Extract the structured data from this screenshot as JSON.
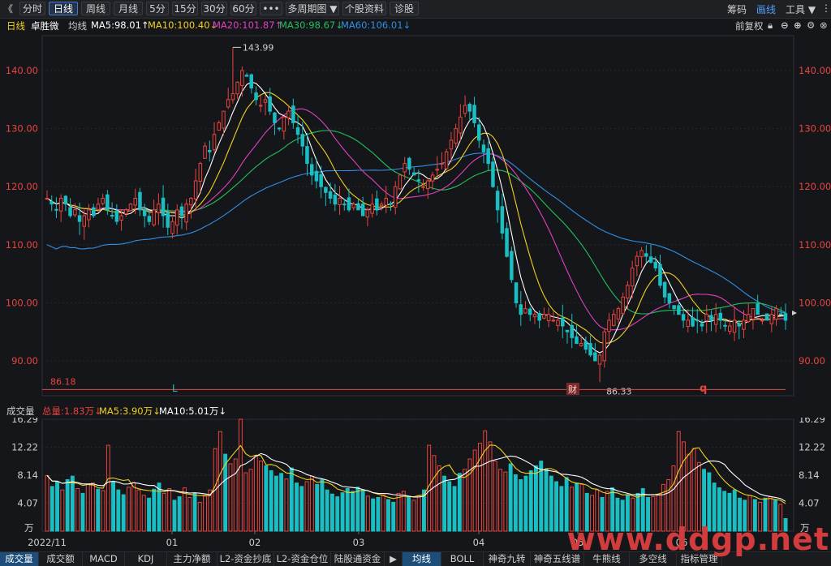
{
  "toolbar": {
    "back": "《",
    "buttons": [
      "分时",
      "日线",
      "周线",
      "月线",
      "5分",
      "15分",
      "30分",
      "60分",
      "•••",
      "多周期图 ▼",
      "个股资料",
      "诊股"
    ],
    "active_index": 1,
    "right": {
      "chips": "筹码",
      "draw": "画线",
      "tools": "工具 ▼"
    }
  },
  "info": {
    "period": "日线",
    "name": "卓胜微",
    "ma_label": "均线",
    "ma5": "MA5:98.01↑",
    "ma10": "MA10:100.40↓",
    "ma20": "MA20:101.87↑",
    "ma30": "MA30:98.67↓",
    "ma60": "MA60:106.01↓",
    "adjust": "前复权",
    "icons": [
      "lock-icon",
      "minus-icon",
      "plus-icon",
      "settings-icon",
      "close-icon"
    ]
  },
  "colors": {
    "up": "#e8443e",
    "down": "#19bfc3",
    "ma5": "#ffffff",
    "ma10": "#f0d020",
    "ma20": "#e040c0",
    "ma30": "#22c05a",
    "ma60": "#2f8fe6",
    "axis": "#e8443e"
  },
  "price_axis": {
    "labels": [
      "140.00",
      "130.00",
      "120.00",
      "110.00",
      "100.00",
      "90.00"
    ],
    "max_label": "143.99",
    "min_label": "86.33",
    "hline_label": "86.18",
    "markers": {
      "l": "L",
      "cai": "财",
      "q": "q"
    }
  },
  "vol_header": {
    "title": "成交量",
    "total": "总量:1.83万↓",
    "ma5": "MA5:3.90万↓",
    "ma10": "MA10:5.01万↓"
  },
  "vol_axis": {
    "labels": [
      "16.29",
      "12.22",
      "8.14",
      "4.07"
    ],
    "unit": "万"
  },
  "x_axis": {
    "labels": [
      "2022/11",
      "01",
      "02",
      "03",
      "04",
      "05",
      "06"
    ]
  },
  "bottom_tabs": [
    "成交量",
    "成交额",
    "MACD",
    "KDJ",
    "主力净额",
    "L2-资金抄底",
    "L2-资金仓位",
    "陆股通资金",
    "▶",
    "均线",
    "BOLL",
    "神奇九转",
    "神奇五线谱",
    "牛熊线",
    "多空线",
    "指标管理"
  ],
  "watermark": "www.ddgp.net",
  "chart_data": {
    "type": "candlestick",
    "ylim": [
      84,
      146
    ],
    "candles_count": 174,
    "closes": [
      118,
      117,
      116,
      118,
      117,
      115,
      116,
      114,
      115,
      116,
      115,
      117,
      118,
      116,
      115,
      114,
      115,
      116,
      117,
      118,
      116,
      115,
      114,
      116,
      117,
      115,
      113,
      114,
      116,
      115,
      117,
      118,
      121,
      124,
      127,
      126,
      129,
      131,
      133,
      135,
      136,
      138,
      140,
      139,
      137,
      135,
      134,
      135,
      133,
      131,
      130,
      132,
      133,
      131,
      129,
      127,
      124,
      122,
      121,
      120,
      119,
      118,
      117,
      118,
      117,
      116,
      117,
      116,
      115,
      116,
      117,
      116,
      117,
      118,
      117,
      120,
      122,
      124,
      123,
      122,
      121,
      120,
      121,
      122,
      123,
      124,
      126,
      128,
      130,
      132,
      134,
      133,
      131,
      128,
      126,
      124,
      120,
      116,
      112,
      108,
      104,
      100,
      98,
      99,
      98,
      98,
      97,
      98,
      98,
      97,
      97,
      96,
      95,
      94,
      93,
      93,
      92,
      91,
      90,
      91,
      95,
      97,
      98,
      99,
      101,
      103,
      106,
      108,
      109,
      108,
      107,
      106,
      103,
      101,
      100,
      99,
      98,
      97,
      97,
      96,
      97,
      96,
      98,
      97,
      98,
      97,
      96,
      96,
      97,
      96,
      97,
      98,
      99,
      98,
      97,
      97,
      98,
      99,
      98,
      97
    ],
    "volumes": [
      8.1,
      6.5,
      7.2,
      6.0,
      7.5,
      8.0,
      6.2,
      5.5,
      6.8,
      7.0,
      6.1,
      5.9,
      12.5,
      7.2,
      6.0,
      5.3,
      6.4,
      7.1,
      6.0,
      5.2,
      4.8,
      6.1,
      7.0,
      5.5,
      6.2,
      4.5,
      5.0,
      6.3,
      4.9,
      5.5,
      4.2,
      5.1,
      6.0,
      12.0,
      14.5,
      11.2,
      9.8,
      10.5,
      16.29,
      8.5,
      9.0,
      11.0,
      10.2,
      9.5,
      8.8,
      8.0,
      8.4,
      7.6,
      9.2,
      7.0,
      6.5,
      7.2,
      8.0,
      6.8,
      7.5,
      6.0,
      5.4,
      5.0,
      5.6,
      6.2,
      5.8,
      6.4,
      5.9,
      5.1,
      4.7,
      4.9,
      5.3,
      4.6,
      4.2,
      5.5,
      5.8,
      5.0,
      4.5,
      5.1,
      6.0,
      12.5,
      11.0,
      9.5,
      8.0,
      7.2,
      6.5,
      8.4,
      9.0,
      10.5,
      11.8,
      12.8,
      14.6,
      13.0,
      10.2,
      9.0,
      8.6,
      9.8,
      8.2,
      7.5,
      8.0,
      8.8,
      9.5,
      10.2,
      9.0,
      8.0,
      7.2,
      6.5,
      7.8,
      6.4,
      7.0,
      6.8,
      5.5,
      5.2,
      6.0,
      4.9,
      5.8,
      6.3,
      4.8,
      4.5,
      5.2,
      4.8,
      5.5,
      6.2,
      4.9,
      5.0,
      5.4,
      6.8,
      7.5,
      9.5,
      14.5,
      13.0,
      11.2,
      12.0,
      10.0,
      9.0,
      8.5,
      7.0,
      6.3,
      5.8,
      5.5,
      6.0,
      4.8,
      4.5,
      5.2,
      4.6,
      4.2,
      4.8,
      5.0,
      4.5,
      3.9,
      1.83
    ]
  }
}
